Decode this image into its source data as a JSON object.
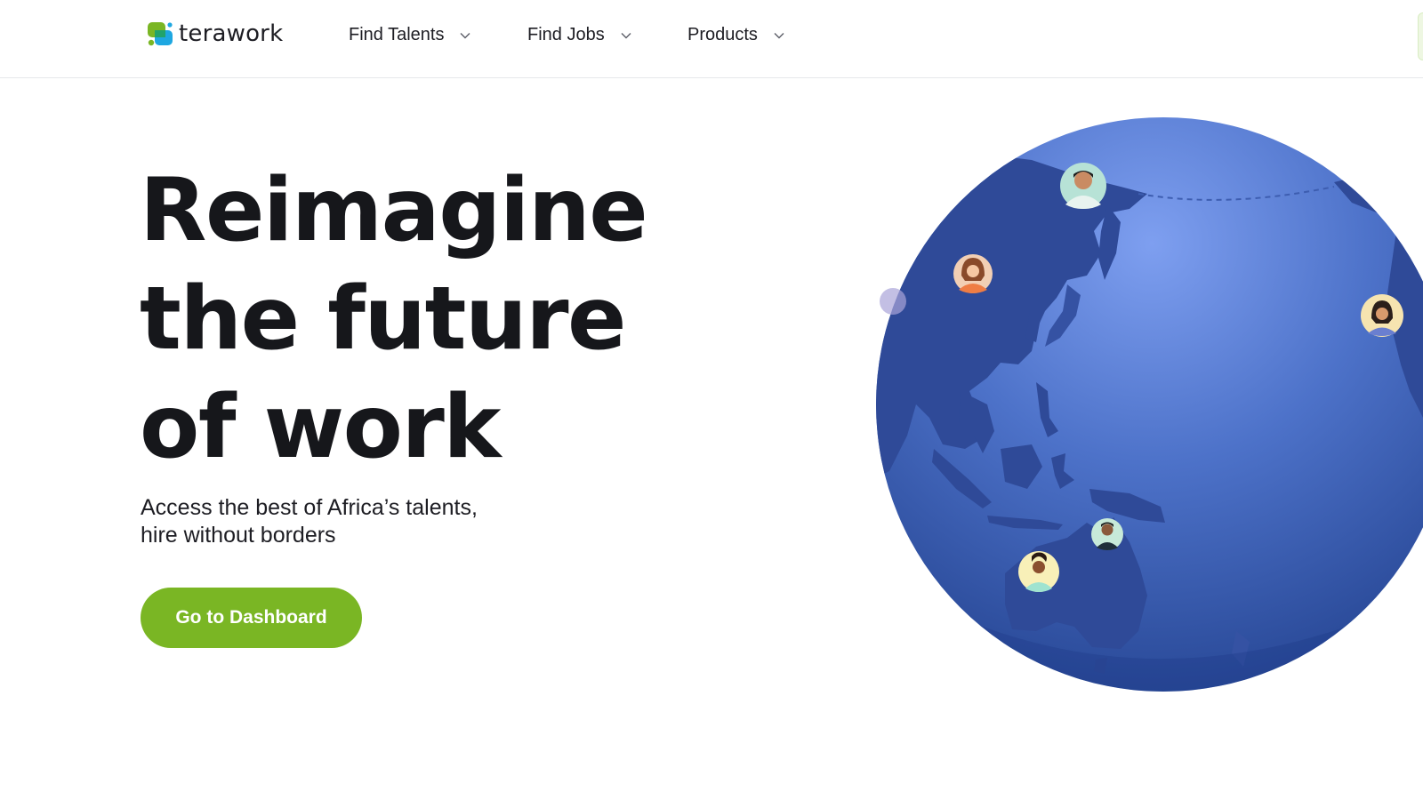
{
  "brand": {
    "name": "terawork",
    "colors": {
      "green": "#7ab624",
      "blue": "#1ea7e1"
    }
  },
  "nav": {
    "items": [
      {
        "label": "Find Talents",
        "icon": "chevron-down-icon"
      },
      {
        "label": "Find Jobs",
        "icon": "chevron-down-icon"
      },
      {
        "label": "Products",
        "icon": "chevron-down-icon"
      }
    ]
  },
  "hero": {
    "title_lines": [
      "Reimagine",
      "the future",
      "of work"
    ],
    "subtitle_lines": [
      "Access the best of Africa’s talents,",
      "hire without borders"
    ],
    "cta_label": "Go to Dashboard",
    "cta_color": "#7ab624"
  },
  "globe": {
    "ocean_color": "#3a5fb8",
    "land_color": "#2f4a96",
    "avatar_icons": [
      "avatar-man-icon",
      "avatar-woman-icon",
      "avatar-woman-icon",
      "avatar-man-icon",
      "avatar-woman-icon"
    ]
  }
}
